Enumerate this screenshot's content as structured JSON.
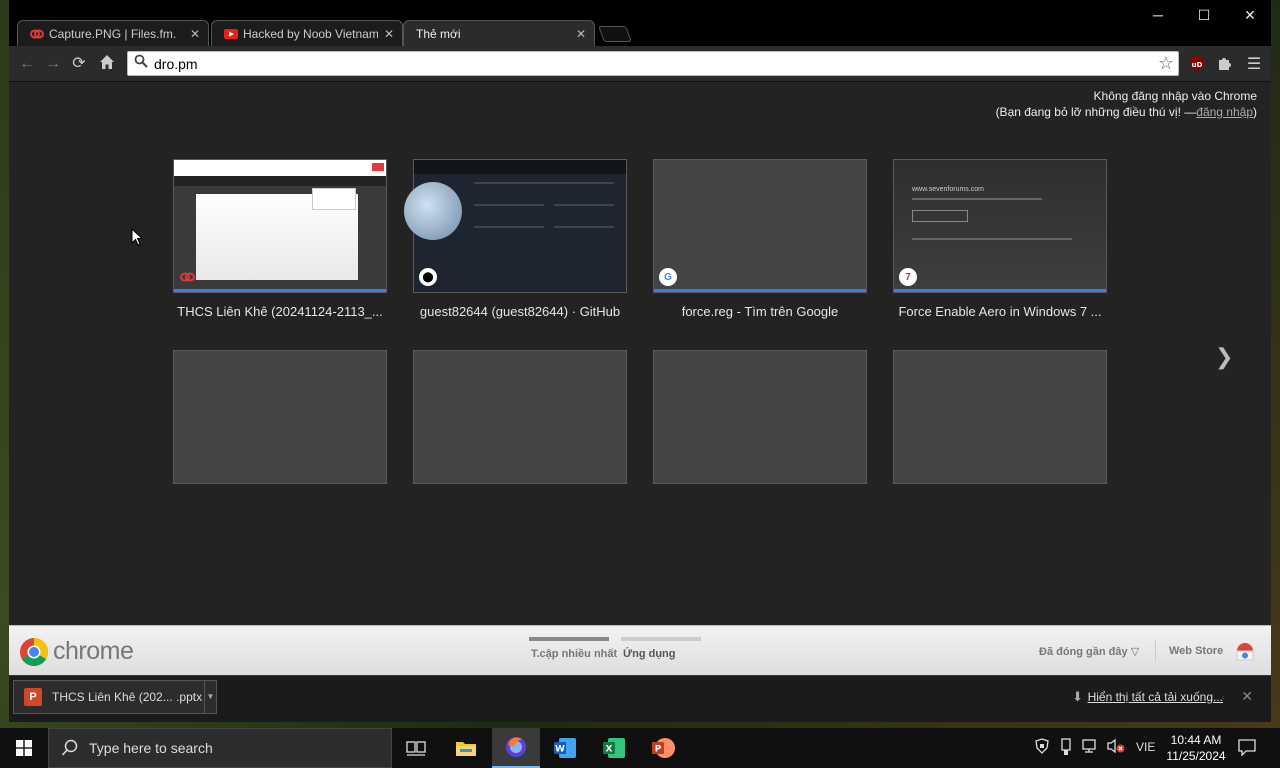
{
  "tabs": [
    {
      "title": "Capture.PNG | Files.fm.",
      "icon": "files-fm-icon"
    },
    {
      "title": "Hacked by Noob Vietnam",
      "icon": "youtube-icon"
    },
    {
      "title": "Thẻ mới",
      "icon": "",
      "active": true
    }
  ],
  "omnibox": {
    "value": "dro.pm"
  },
  "signin": {
    "line1": "Không đăng nhập vào Chrome",
    "line2_prefix": "(Bạn đang bỏ lỡ những điều thú vị! —",
    "link": "đăng nhập",
    "line2_suffix": ")"
  },
  "most_visited": [
    {
      "title": "THCS Liên Khê (20241124-2113_..."
    },
    {
      "title": "guest82644 (guest82644) · GitHub"
    },
    {
      "title": "force.reg - Tìm trên Google"
    },
    {
      "title": "Force Enable Aero in Windows 7 ..."
    }
  ],
  "thumb_texts": {
    "sevenforums": "www.sevenforums.com"
  },
  "footer": {
    "brand": "chrome",
    "pages": [
      "T.cập nhiều nhất",
      "Ứng dụng"
    ],
    "recently_closed": "Đã đóng gần đây",
    "web_store": "Web Store"
  },
  "download": {
    "file": "THCS Liên Khê (202... .pptx",
    "show_all": "Hiển thị tất cả tải xuống..."
  },
  "taskbar": {
    "search_placeholder": "Type here to search",
    "lang": "VIE",
    "time": "10:44 AM",
    "date": "11/25/2024"
  },
  "colors": {
    "accent": "#3b7de0",
    "footer_bg": "#e8e8e8",
    "content_bg": "#232323"
  }
}
